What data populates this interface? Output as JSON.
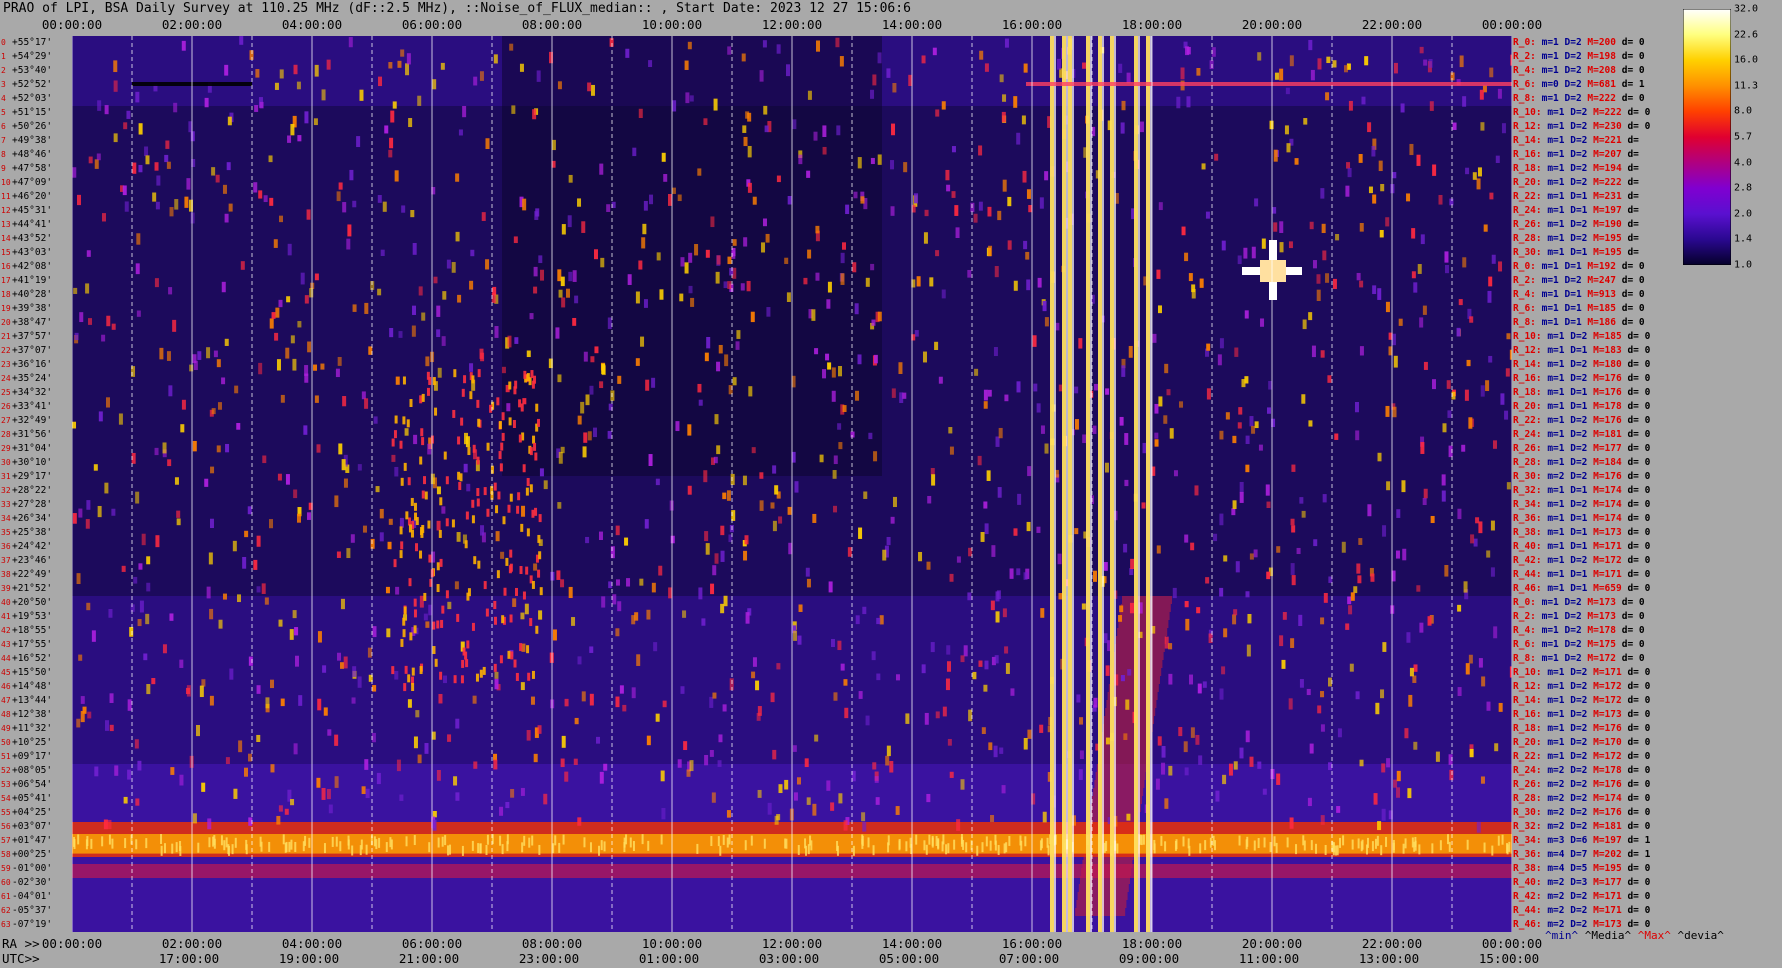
{
  "title": "PRAO of LPI, BSA Daily Survey at 110.25 MHz (dF::2.5 MHz), ::Noise_of_FLUX_median:: , Start Date: 2023 12 27 15:06:6",
  "top_ticks": [
    "00:00:00",
    "02:00:00",
    "04:00:00",
    "06:00:00",
    "08:00:00",
    "10:00:00",
    "12:00:00",
    "14:00:00",
    "16:00:00",
    "18:00:00",
    "20:00:00",
    "22:00:00",
    "00:00:00"
  ],
  "bottom_ra_prefix": "RA >>",
  "bottom_ra_ticks": [
    "00:00:00",
    "02:00:00",
    "04:00:00",
    "06:00:00",
    "08:00:00",
    "10:00:00",
    "12:00:00",
    "14:00:00",
    "16:00:00",
    "18:00:00",
    "20:00:00",
    "22:00:00",
    "00:00:00"
  ],
  "bottom_utc_prefix": "UTC>>",
  "bottom_utc_ticks": [
    "17:00:00",
    "19:00:00",
    "21:00:00",
    "23:00:00",
    "01:00:00",
    "03:00:00",
    "05:00:00",
    "07:00:00",
    "09:00:00",
    "11:00:00",
    "13:00:00",
    "15:00:00"
  ],
  "colorbar": {
    "labels": [
      "32.0",
      "22.6",
      "16.0",
      "11.3",
      "8.0",
      "5.7",
      "4.0",
      "2.8",
      "2.0",
      "1.4",
      "1.0"
    ],
    "stops": [
      "#ffffff",
      "#ffff80",
      "#ffd000",
      "#ff9000",
      "#ff4000",
      "#e00030",
      "#b00080",
      "#8000d0",
      "#5a10d0",
      "#2a0890",
      "#05002a"
    ]
  },
  "legend": {
    "min": "^min^",
    "median": "^Media^",
    "max": "^Max^",
    "dev": "^devia^"
  },
  "dec_rows": [
    {
      "i": "0",
      "dec": "+55°17'"
    },
    {
      "i": "1",
      "dec": "+54°29'"
    },
    {
      "i": "2",
      "dec": "+53°40'"
    },
    {
      "i": "3",
      "dec": "+52°52'"
    },
    {
      "i": "4",
      "dec": "+52°03'"
    },
    {
      "i": "5",
      "dec": "+51°15'"
    },
    {
      "i": "6",
      "dec": "+50°26'"
    },
    {
      "i": "7",
      "dec": "+49°38'"
    },
    {
      "i": "8",
      "dec": "+48°46'"
    },
    {
      "i": "9",
      "dec": "+47°58'"
    },
    {
      "i": "10",
      "dec": "+47°09'"
    },
    {
      "i": "11",
      "dec": "+46°20'"
    },
    {
      "i": "12",
      "dec": "+45°31'"
    },
    {
      "i": "13",
      "dec": "+44°41'"
    },
    {
      "i": "14",
      "dec": "+43°52'"
    },
    {
      "i": "15",
      "dec": "+43°03'"
    },
    {
      "i": "16",
      "dec": "+42°08'"
    },
    {
      "i": "17",
      "dec": "+41°19'"
    },
    {
      "i": "18",
      "dec": "+40°28'"
    },
    {
      "i": "19",
      "dec": "+39°38'"
    },
    {
      "i": "20",
      "dec": "+38°47'"
    },
    {
      "i": "21",
      "dec": "+37°57'"
    },
    {
      "i": "22",
      "dec": "+37°07'"
    },
    {
      "i": "23",
      "dec": "+36°16'"
    },
    {
      "i": "24",
      "dec": "+35°24'"
    },
    {
      "i": "25",
      "dec": "+34°32'"
    },
    {
      "i": "26",
      "dec": "+33°41'"
    },
    {
      "i": "27",
      "dec": "+32°49'"
    },
    {
      "i": "28",
      "dec": "+31°56'"
    },
    {
      "i": "29",
      "dec": "+31°04'"
    },
    {
      "i": "30",
      "dec": "+30°10'"
    },
    {
      "i": "31",
      "dec": "+29°17'"
    },
    {
      "i": "32",
      "dec": "+28°22'"
    },
    {
      "i": "33",
      "dec": "+27°28'"
    },
    {
      "i": "34",
      "dec": "+26°34'"
    },
    {
      "i": "35",
      "dec": "+25°38'"
    },
    {
      "i": "36",
      "dec": "+24°42'"
    },
    {
      "i": "37",
      "dec": "+23°46'"
    },
    {
      "i": "38",
      "dec": "+22°49'"
    },
    {
      "i": "39",
      "dec": "+21°52'"
    },
    {
      "i": "40",
      "dec": "+20°50'"
    },
    {
      "i": "41",
      "dec": "+19°53'"
    },
    {
      "i": "42",
      "dec": "+18°55'"
    },
    {
      "i": "43",
      "dec": "+17°55'"
    },
    {
      "i": "44",
      "dec": "+16°52'"
    },
    {
      "i": "45",
      "dec": "+15°50'"
    },
    {
      "i": "46",
      "dec": "+14°48'"
    },
    {
      "i": "47",
      "dec": "+13°44'"
    },
    {
      "i": "48",
      "dec": "+12°38'"
    },
    {
      "i": "49",
      "dec": "+11°32'"
    },
    {
      "i": "50",
      "dec": "+10°25'"
    },
    {
      "i": "51",
      "dec": "+09°17'"
    },
    {
      "i": "52",
      "dec": "+08°05'"
    },
    {
      "i": "53",
      "dec": "+06°54'"
    },
    {
      "i": "54",
      "dec": "+05°41'"
    },
    {
      "i": "55",
      "dec": "+04°25'"
    },
    {
      "i": "56",
      "dec": "+03°07'"
    },
    {
      "i": "57",
      "dec": "+01°47'"
    },
    {
      "i": "58",
      "dec": "+00°25'"
    },
    {
      "i": "59",
      "dec": "-01°00'"
    },
    {
      "i": "60",
      "dec": "-02°30'"
    },
    {
      "i": "61",
      "dec": "-04°01'"
    },
    {
      "i": "62",
      "dec": "-05°37'"
    },
    {
      "i": "63",
      "dec": "-07°19'"
    }
  ],
  "stats_rows": [
    {
      "r": "R_0:",
      "m": "m=1",
      "d": "D=2",
      "M": "M=200",
      "dv": "d= 0"
    },
    {
      "r": "R_2:",
      "m": "m=1",
      "d": "D=2",
      "M": "M=198",
      "dv": "d= 0"
    },
    {
      "r": "R_4:",
      "m": "m=1",
      "d": "D=2",
      "M": "M=208",
      "dv": "d= 0"
    },
    {
      "r": "R_6:",
      "m": "m=0",
      "d": "D=2",
      "M": "M=681",
      "dv": "d= 1"
    },
    {
      "r": "R_8:",
      "m": "m=1",
      "d": "D=2",
      "M": "M=222",
      "dv": "d= 0"
    },
    {
      "r": "R_10:",
      "m": "m=1",
      "d": "D=2",
      "M": "M=222",
      "dv": "d= 0"
    },
    {
      "r": "R_12:",
      "m": "m=1",
      "d": "D=2",
      "M": "M=230",
      "dv": "d= 0"
    },
    {
      "r": "R_14:",
      "m": "m=1",
      "d": "D=2",
      "M": "M=221",
      "dv": "d="
    },
    {
      "r": "R_16:",
      "m": "m=1",
      "d": "D=2",
      "M": "M=207",
      "dv": "d="
    },
    {
      "r": "R_18:",
      "m": "m=1",
      "d": "D=2",
      "M": "M=194",
      "dv": "d="
    },
    {
      "r": "R_20:",
      "m": "m=1",
      "d": "D=2",
      "M": "M=222",
      "dv": "d="
    },
    {
      "r": "R_22:",
      "m": "m=1",
      "d": "D=1",
      "M": "M=231",
      "dv": "d="
    },
    {
      "r": "R_24:",
      "m": "m=1",
      "d": "D=1",
      "M": "M=197",
      "dv": "d="
    },
    {
      "r": "R_26:",
      "m": "m=1",
      "d": "D=2",
      "M": "M=190",
      "dv": "d="
    },
    {
      "r": "R_28:",
      "m": "m=1",
      "d": "D=2",
      "M": "M=195",
      "dv": "d="
    },
    {
      "r": "R_30:",
      "m": "m=1",
      "d": "D=1",
      "M": "M=195",
      "dv": "d="
    },
    {
      "r": "R_0:",
      "m": "m=1",
      "d": "D=1",
      "M": "M=192",
      "dv": "d= 0"
    },
    {
      "r": "R_2:",
      "m": "m=1",
      "d": "D=2",
      "M": "M=247",
      "dv": "d= 0"
    },
    {
      "r": "R_4:",
      "m": "m=1",
      "d": "D=1",
      "M": "M=913",
      "dv": "d= 0"
    },
    {
      "r": "R_6:",
      "m": "m=1",
      "d": "D=1",
      "M": "M=185",
      "dv": "d= 0"
    },
    {
      "r": "R_8:",
      "m": "m=1",
      "d": "D=1",
      "M": "M=186",
      "dv": "d= 0"
    },
    {
      "r": "R_10:",
      "m": "m=1",
      "d": "D=2",
      "M": "M=185",
      "dv": "d= 0"
    },
    {
      "r": "R_12:",
      "m": "m=1",
      "d": "D=1",
      "M": "M=183",
      "dv": "d= 0"
    },
    {
      "r": "R_14:",
      "m": "m=1",
      "d": "D=2",
      "M": "M=180",
      "dv": "d= 0"
    },
    {
      "r": "R_16:",
      "m": "m=1",
      "d": "D=2",
      "M": "M=176",
      "dv": "d= 0"
    },
    {
      "r": "R_18:",
      "m": "m=1",
      "d": "D=1",
      "M": "M=176",
      "dv": "d= 0"
    },
    {
      "r": "R_20:",
      "m": "m=1",
      "d": "D=1",
      "M": "M=178",
      "dv": "d= 0"
    },
    {
      "r": "R_22:",
      "m": "m=1",
      "d": "D=2",
      "M": "M=176",
      "dv": "d= 0"
    },
    {
      "r": "R_24:",
      "m": "m=1",
      "d": "D=2",
      "M": "M=181",
      "dv": "d= 0"
    },
    {
      "r": "R_26:",
      "m": "m=1",
      "d": "D=2",
      "M": "M=177",
      "dv": "d= 0"
    },
    {
      "r": "R_28:",
      "m": "m=1",
      "d": "D=2",
      "M": "M=184",
      "dv": "d= 0"
    },
    {
      "r": "R_30:",
      "m": "m=2",
      "d": "D=2",
      "M": "M=176",
      "dv": "d= 0"
    },
    {
      "r": "R_32:",
      "m": "m=1",
      "d": "D=1",
      "M": "M=174",
      "dv": "d= 0"
    },
    {
      "r": "R_34:",
      "m": "m=1",
      "d": "D=2",
      "M": "M=174",
      "dv": "d= 0"
    },
    {
      "r": "R_36:",
      "m": "m=1",
      "d": "D=1",
      "M": "M=174",
      "dv": "d= 0"
    },
    {
      "r": "R_38:",
      "m": "m=1",
      "d": "D=1",
      "M": "M=173",
      "dv": "d= 0"
    },
    {
      "r": "R_40:",
      "m": "m=1",
      "d": "D=1",
      "M": "M=171",
      "dv": "d= 0"
    },
    {
      "r": "R_42:",
      "m": "m=1",
      "d": "D=2",
      "M": "M=172",
      "dv": "d= 0"
    },
    {
      "r": "R_44:",
      "m": "m=1",
      "d": "D=1",
      "M": "M=171",
      "dv": "d= 0"
    },
    {
      "r": "R_46:",
      "m": "m=1",
      "d": "D=1",
      "M": "M=659",
      "dv": "d= 0"
    },
    {
      "r": "R_0:",
      "m": "m=1",
      "d": "D=2",
      "M": "M=173",
      "dv": "d= 0"
    },
    {
      "r": "R_2:",
      "m": "m=1",
      "d": "D=2",
      "M": "M=173",
      "dv": "d= 0"
    },
    {
      "r": "R_4:",
      "m": "m=1",
      "d": "D=2",
      "M": "M=178",
      "dv": "d= 0"
    },
    {
      "r": "R_6:",
      "m": "m=1",
      "d": "D=2",
      "M": "M=175",
      "dv": "d= 0"
    },
    {
      "r": "R_8:",
      "m": "m=1",
      "d": "D=2",
      "M": "M=172",
      "dv": "d= 0"
    },
    {
      "r": "R_10:",
      "m": "m=1",
      "d": "D=2",
      "M": "M=171",
      "dv": "d= 0"
    },
    {
      "r": "R_12:",
      "m": "m=1",
      "d": "D=2",
      "M": "M=172",
      "dv": "d= 0"
    },
    {
      "r": "R_14:",
      "m": "m=1",
      "d": "D=2",
      "M": "M=172",
      "dv": "d= 0"
    },
    {
      "r": "R_16:",
      "m": "m=1",
      "d": "D=2",
      "M": "M=173",
      "dv": "d= 0"
    },
    {
      "r": "R_18:",
      "m": "m=1",
      "d": "D=2",
      "M": "M=176",
      "dv": "d= 0"
    },
    {
      "r": "R_20:",
      "m": "m=1",
      "d": "D=2",
      "M": "M=170",
      "dv": "d= 0"
    },
    {
      "r": "R_22:",
      "m": "m=1",
      "d": "D=2",
      "M": "M=172",
      "dv": "d= 0"
    },
    {
      "r": "R_24:",
      "m": "m=2",
      "d": "D=2",
      "M": "M=178",
      "dv": "d= 0"
    },
    {
      "r": "R_26:",
      "m": "m=2",
      "d": "D=2",
      "M": "M=176",
      "dv": "d= 0"
    },
    {
      "r": "R_28:",
      "m": "m=2",
      "d": "D=2",
      "M": "M=174",
      "dv": "d= 0"
    },
    {
      "r": "R_30:",
      "m": "m=2",
      "d": "D=2",
      "M": "M=176",
      "dv": "d= 0"
    },
    {
      "r": "R_32:",
      "m": "m=2",
      "d": "D=2",
      "M": "M=181",
      "dv": "d= 0"
    },
    {
      "r": "R_34:",
      "m": "m=3",
      "d": "D=6",
      "M": "M=197",
      "dv": "d= 1"
    },
    {
      "r": "R_36:",
      "m": "m=4",
      "d": "D=7",
      "M": "M=202",
      "dv": "d= 1"
    },
    {
      "r": "R_38:",
      "m": "m=4",
      "d": "D=5",
      "M": "M=195",
      "dv": "d= 0"
    },
    {
      "r": "R_40:",
      "m": "m=2",
      "d": "D=3",
      "M": "M=177",
      "dv": "d= 0"
    },
    {
      "r": "R_42:",
      "m": "m=2",
      "d": "D=2",
      "M": "M=171",
      "dv": "d= 0"
    },
    {
      "r": "R_44:",
      "m": "m=2",
      "d": "D=2",
      "M": "M=171",
      "dv": "d= 0"
    },
    {
      "r": "R_46:",
      "m": "m=2",
      "d": "D=2",
      "M": "M=173",
      "dv": "d= 0"
    }
  ],
  "chart_data": {
    "type": "heatmap",
    "title": "PRAO of LPI, BSA Daily Survey at 110.25 MHz (dF::2.5 MHz), ::Noise_of_FLUX_median:: , Start Date: 2023 12 27 15:06:6",
    "x_axis": "RA (hours, 0-24) / UTC",
    "y_axis": "Declination beams (64 rows, +55°17' to -07°19')",
    "xlim": [
      0,
      24
    ],
    "color_scale": [
      1.0,
      32.0
    ],
    "bright_features": [
      {
        "ra_start": 16.2,
        "ra_end": 17.9,
        "rows": [
          0,
          63
        ],
        "level": 32
      },
      {
        "ra_start": 19.9,
        "ra_end": 20.1,
        "rows": [
          15,
          20
        ],
        "level": 32
      },
      {
        "ra_start": 0.0,
        "ra_end": 24.0,
        "rows": [
          56,
          59
        ],
        "level": 11
      }
    ]
  }
}
